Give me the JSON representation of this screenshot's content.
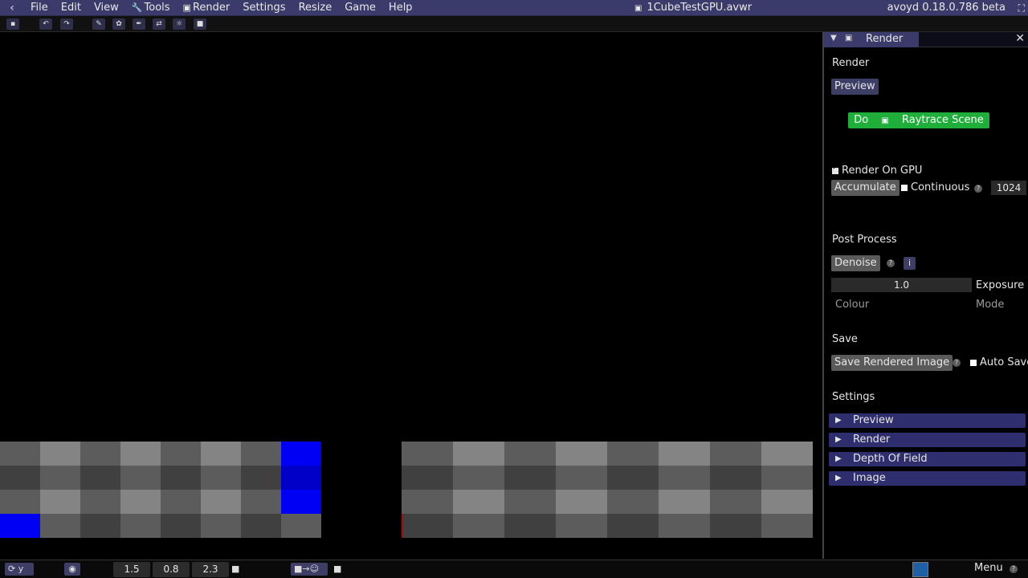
{
  "menubar": {
    "items": [
      "File",
      "Edit",
      "View",
      "Tools",
      "Render",
      "Settings",
      "Resize",
      "Game",
      "Help"
    ],
    "icons": {
      "back": "chevron-left-icon",
      "tools": "wrench-icon",
      "render": "image-icon"
    },
    "file_title": "1CubeTestGPU.avwr",
    "version": "avoyd 0.18.0.786 beta"
  },
  "toolbar": {
    "buttons": [
      "save-icon",
      "undo-icon",
      "redo-icon",
      "pencil-icon",
      "brush-icon",
      "eyedropper-icon",
      "swap-icon",
      "sun-icon",
      "camera-icon"
    ]
  },
  "viewport": {
    "colors": {
      "light": "#848484",
      "mid": "#5c5c5c",
      "dark": "#404040",
      "blue": "#0000f5",
      "blue_dark": "#0000c8"
    }
  },
  "panel": {
    "tab_label": "Render",
    "render_section": "Render",
    "preview_button": "Preview",
    "do_label": "Do",
    "raytrace_label": "Raytrace Scene",
    "render_on_gpu": "Render On GPU",
    "accumulate_button": "Accumulate",
    "continuous_label": "Continuous",
    "samples_value": "1024",
    "post_process_section": "Post Process",
    "denoise_button": "Denoise",
    "info_button": "i",
    "exposure_value": "1.0",
    "exposure_label": "Exposure",
    "colour_label": "Colour",
    "mode_label": "Mode",
    "save_section": "Save",
    "save_rendered_button": "Save Rendered Image",
    "auto_save_label": "Auto Save",
    "settings_section": "Settings",
    "settings_items": [
      "Preview",
      "Render",
      "Depth Of Field",
      "Image"
    ]
  },
  "statusbar": {
    "axis_label": "y",
    "x_value": "1.5",
    "y_value": "0.8",
    "z_value": "2.3",
    "menu_label": "Menu",
    "swatch_color": "#1f5fa6"
  }
}
